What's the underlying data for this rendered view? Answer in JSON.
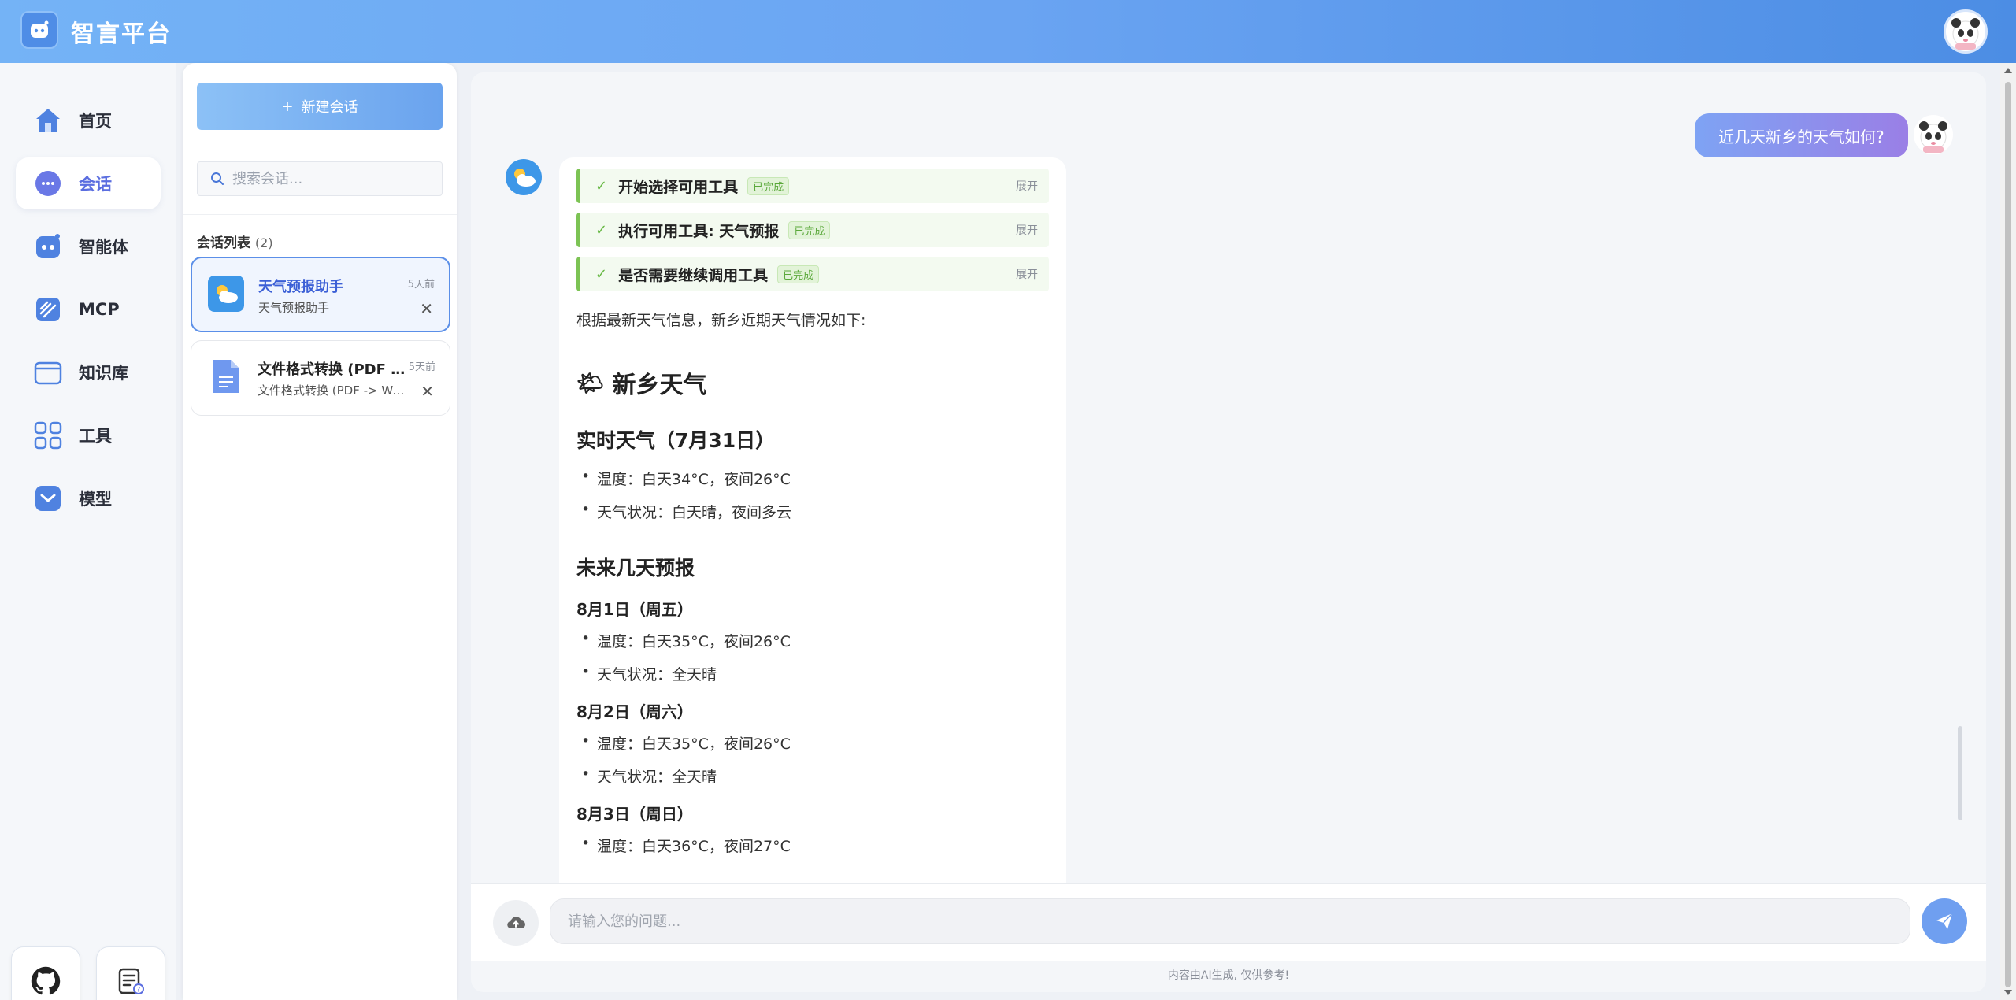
{
  "app": {
    "title": "智言平台"
  },
  "nav": {
    "items": [
      {
        "label": "首页",
        "icon": "home-icon"
      },
      {
        "label": "会话",
        "icon": "chat-icon",
        "active": true
      },
      {
        "label": "智能体",
        "icon": "robot-icon"
      },
      {
        "label": "MCP",
        "icon": "mcp-icon"
      },
      {
        "label": "知识库",
        "icon": "folder-icon"
      },
      {
        "label": "工具",
        "icon": "grid-icon"
      },
      {
        "label": "模型",
        "icon": "cube-icon"
      }
    ],
    "footer": [
      {
        "icon": "github-icon"
      },
      {
        "icon": "docs-icon"
      }
    ]
  },
  "sessions": {
    "new_chat_label": "新建会话",
    "search_placeholder": "搜索会话...",
    "list_title": "会话列表",
    "count": "(2)",
    "items": [
      {
        "title": "天气预报助手",
        "subtitle": "天气预报助手",
        "time": "5天前",
        "icon": "weather-icon",
        "active": true
      },
      {
        "title": "文件格式转换 (PDF -> Word)",
        "subtitle": "文件格式转换 (PDF -> Word)",
        "time": "5天前",
        "icon": "document-icon"
      }
    ]
  },
  "chat": {
    "user_message": "近几天新乡的天气如何?",
    "tool_steps": [
      {
        "label": "开始选择可用工具",
        "status": "已完成",
        "expand": "展开"
      },
      {
        "label": "执行可用工具: 天气预报",
        "status": "已完成",
        "expand": "展开"
      },
      {
        "label": "是否需要继续调用工具",
        "status": "已完成",
        "expand": "展开"
      }
    ],
    "answer": {
      "intro": "根据最新天气信息，新乡近期天气情况如下:",
      "h1_emoji": "🌤",
      "h1": "新乡天气",
      "realtime_title": "实时天气（7月31日）",
      "realtime": [
        "温度：白天34°C，夜间26°C",
        "天气状况：白天晴，夜间多云"
      ],
      "forecast_title": "未来几天预报",
      "days": [
        {
          "title": "8月1日（周五）",
          "items": [
            "温度：白天35°C，夜间26°C",
            "天气状况：全天晴"
          ]
        },
        {
          "title": "8月2日（周六）",
          "items": [
            "温度：白天35°C，夜间26°C",
            "天气状况：全天晴"
          ]
        },
        {
          "title": "8月3日（周日）",
          "items": [
            "温度：白天36°C，夜间27°C"
          ]
        }
      ]
    },
    "input_placeholder": "请输入您的问题...",
    "disclaimer": "内容由AI生成, 仅供参考!"
  },
  "colors": {
    "accent": "#5b6ee0",
    "header_start": "#74b3f6",
    "header_end": "#4c8de4",
    "success": "#67b844"
  }
}
